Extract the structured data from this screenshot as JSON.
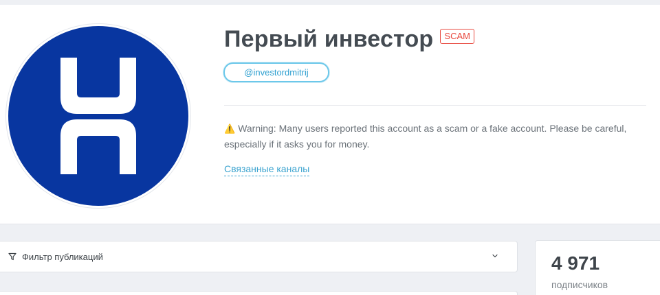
{
  "channel": {
    "title": "Первый инвестор",
    "badge": "SCAM",
    "handle": "@investordmitrij",
    "avatar_icon": "channel-logo-icon",
    "avatar_color": "#0836a0"
  },
  "warning": {
    "icon": "warning-icon",
    "text": "Warning: Many users reported this account as a scam or a fake account. Please be careful, especially if it asks you for money."
  },
  "related_link": "Связанные каналы",
  "filter": {
    "icon": "filter-icon",
    "label": "Фильтр публикаций",
    "chevron_icon": "chevron-down-icon"
  },
  "stats": {
    "subscribers_count": "4 971",
    "subscribers_label": "подписчиков"
  },
  "colors": {
    "scam_red": "#e8493f",
    "link_blue": "#3ba3cf",
    "background": "#eef0f4"
  }
}
